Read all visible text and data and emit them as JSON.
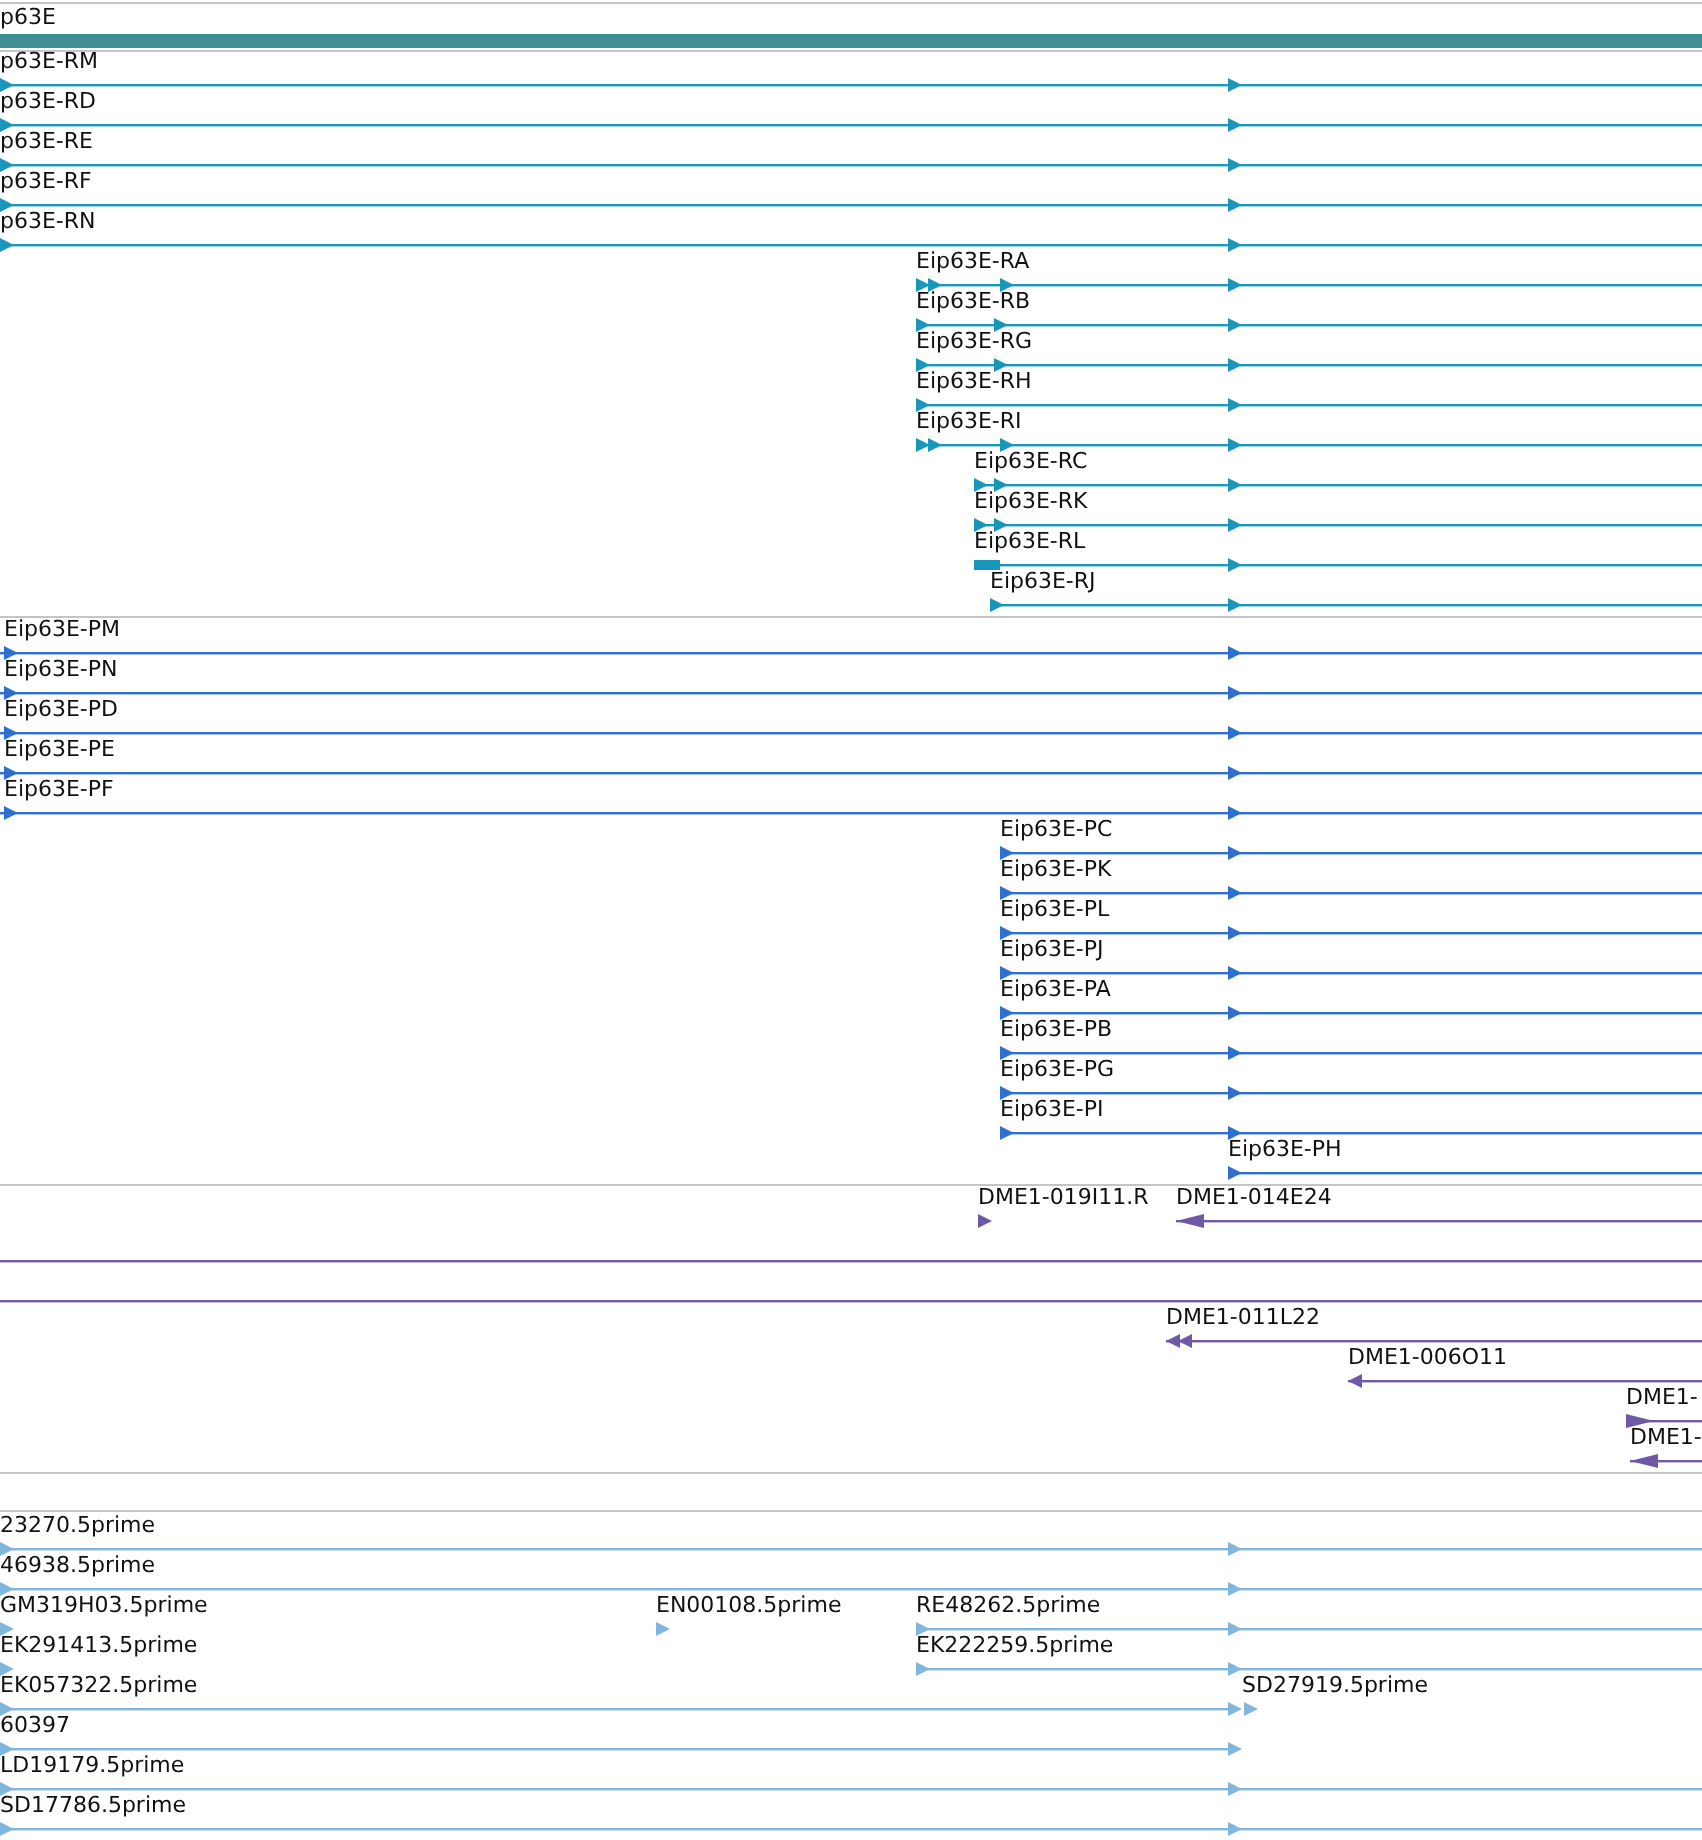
{
  "tracks": [
    {
      "color": "#3d8f93",
      "rows": [
        {
          "features": [
            {
              "kind": "gene",
              "label": "p63E"
            }
          ]
        }
      ]
    },
    {
      "color": "#1a96ba",
      "rows": [
        {
          "features": [
            {
              "kind": "transcript",
              "label": "p63E-RM"
            }
          ]
        },
        {
          "features": [
            {
              "kind": "transcript",
              "label": "p63E-RD"
            }
          ]
        },
        {
          "features": [
            {
              "kind": "transcript",
              "label": "p63E-RE"
            }
          ]
        },
        {
          "features": [
            {
              "kind": "transcript",
              "label": "p63E-RF"
            }
          ]
        },
        {
          "features": [
            {
              "kind": "transcript",
              "label": "p63E-RN"
            }
          ]
        },
        {
          "features": [
            {
              "kind": "transcript",
              "label": "Eip63E-RA"
            }
          ]
        },
        {
          "features": [
            {
              "kind": "transcript",
              "label": "Eip63E-RB"
            }
          ]
        },
        {
          "features": [
            {
              "kind": "transcript",
              "label": "Eip63E-RG"
            }
          ]
        },
        {
          "features": [
            {
              "kind": "transcript",
              "label": "Eip63E-RH"
            }
          ]
        },
        {
          "features": [
            {
              "kind": "transcript",
              "label": "Eip63E-RI"
            }
          ]
        },
        {
          "features": [
            {
              "kind": "transcript",
              "label": "Eip63E-RC"
            }
          ]
        },
        {
          "features": [
            {
              "kind": "transcript",
              "label": "Eip63E-RK"
            }
          ]
        },
        {
          "features": [
            {
              "kind": "transcript",
              "label": "Eip63E-RL"
            }
          ]
        },
        {
          "features": [
            {
              "kind": "transcript",
              "label": "Eip63E-RJ"
            }
          ]
        }
      ]
    },
    {
      "color": "#2f6fd0",
      "rows": [
        {
          "features": [
            {
              "kind": "transcript",
              "label": "Eip63E-PM"
            }
          ]
        },
        {
          "features": [
            {
              "kind": "transcript",
              "label": "Eip63E-PN"
            }
          ]
        },
        {
          "features": [
            {
              "kind": "transcript",
              "label": "Eip63E-PD"
            }
          ]
        },
        {
          "features": [
            {
              "kind": "transcript",
              "label": "Eip63E-PE"
            }
          ]
        },
        {
          "features": [
            {
              "kind": "transcript",
              "label": "Eip63E-PF"
            }
          ]
        },
        {
          "features": [
            {
              "kind": "transcript",
              "label": "Eip63E-PC"
            }
          ]
        },
        {
          "features": [
            {
              "kind": "transcript",
              "label": "Eip63E-PK"
            }
          ]
        },
        {
          "features": [
            {
              "kind": "transcript",
              "label": "Eip63E-PL"
            }
          ]
        },
        {
          "features": [
            {
              "kind": "transcript",
              "label": "Eip63E-PJ"
            }
          ]
        },
        {
          "features": [
            {
              "kind": "transcript",
              "label": "Eip63E-PA"
            }
          ]
        },
        {
          "features": [
            {
              "kind": "transcript",
              "label": "Eip63E-PB"
            }
          ]
        },
        {
          "features": [
            {
              "kind": "transcript",
              "label": "Eip63E-PG"
            }
          ]
        },
        {
          "features": [
            {
              "kind": "transcript",
              "label": "Eip63E-PI"
            }
          ]
        },
        {
          "features": [
            {
              "kind": "transcript",
              "label": "Eip63E-PH"
            }
          ]
        }
      ]
    },
    {
      "color": "#7058a8",
      "rows": [
        {
          "features": [
            {
              "kind": "transcript",
              "label": "DME1-019I11.R"
            },
            {
              "kind": "transcript",
              "label": "DME1-014E24"
            }
          ]
        },
        {
          "features": [
            {
              "kind": "transcript"
            }
          ]
        },
        {
          "features": [
            {
              "kind": "transcript"
            }
          ]
        },
        {
          "features": [
            {
              "kind": "transcript",
              "label": "DME1-011L22"
            }
          ]
        },
        {
          "features": [
            {
              "kind": "transcript",
              "label": "DME1-006O11"
            }
          ]
        },
        {
          "features": [
            {
              "kind": "transcript",
              "label": "DME1-"
            }
          ]
        },
        {
          "features": [
            {
              "kind": "transcript",
              "label": "DME1-"
            }
          ]
        }
      ]
    },
    {
      "color": "#80b5de",
      "rows": [
        {
          "features": [
            {
              "kind": "transcript",
              "label": "23270.5prime"
            }
          ]
        },
        {
          "features": [
            {
              "kind": "transcript",
              "label": "46938.5prime"
            }
          ]
        },
        {
          "features": [
            {
              "kind": "transcript",
              "label": "GM319H03.5prime"
            },
            {
              "kind": "transcript",
              "label": "EN00108.5prime"
            },
            {
              "kind": "transcript",
              "label": "RE48262.5prime"
            }
          ]
        },
        {
          "features": [
            {
              "kind": "transcript",
              "label": "EK291413.5prime"
            },
            {
              "kind": "transcript",
              "label": "EK222259.5prime"
            }
          ]
        },
        {
          "features": [
            {
              "kind": "transcript",
              "label": "EK057322.5prime"
            },
            {
              "kind": "transcript",
              "label": "SD27919.5prime"
            }
          ]
        },
        {
          "features": [
            {
              "kind": "transcript",
              "label": "60397"
            }
          ]
        },
        {
          "features": [
            {
              "kind": "transcript",
              "label": "LD19179.5prime"
            }
          ]
        },
        {
          "features": [
            {
              "kind": "transcript",
              "label": "SD17786.5prime"
            }
          ]
        }
      ]
    }
  ]
}
